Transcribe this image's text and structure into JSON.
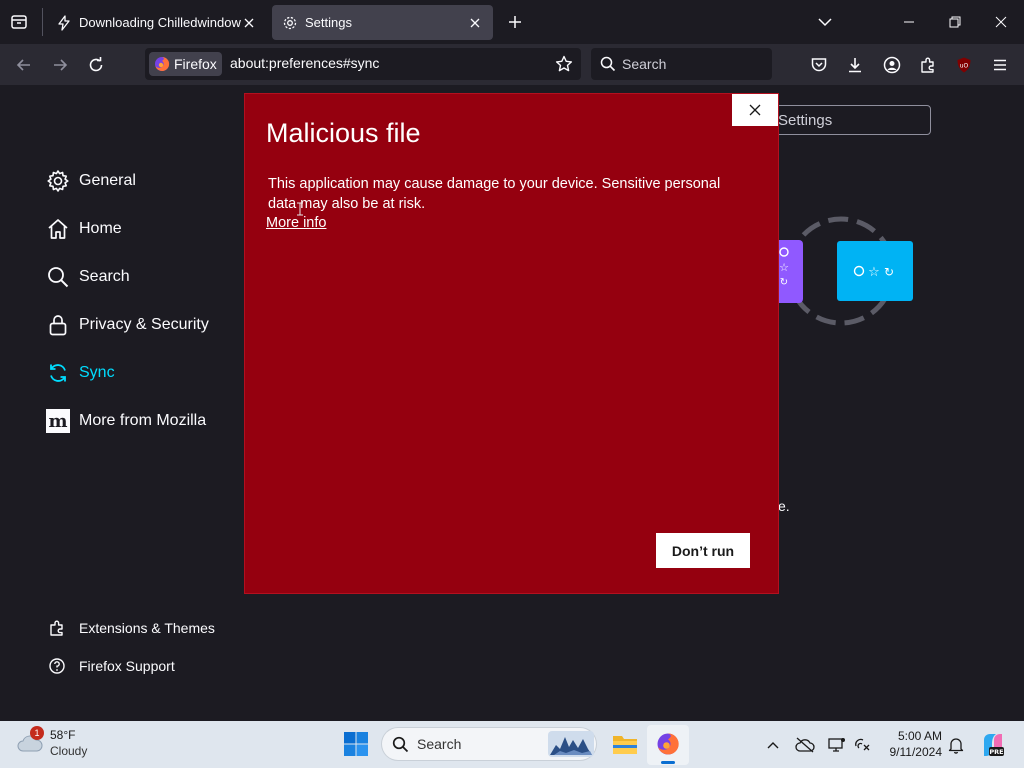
{
  "browser": {
    "tabs": [
      {
        "title": "Downloading Chilledwindows.e",
        "icon": "bolt-icon"
      },
      {
        "title": "Settings",
        "icon": "gear-icon"
      }
    ],
    "identity_label": "Firefox",
    "url": "about:preferences#sync",
    "search_placeholder": "Search"
  },
  "settings": {
    "categories": [
      {
        "label": "General",
        "icon": "gear-icon"
      },
      {
        "label": "Home",
        "icon": "home-icon"
      },
      {
        "label": "Search",
        "icon": "search-icon"
      },
      {
        "label": "Privacy & Security",
        "icon": "lock-icon"
      },
      {
        "label": "Sync",
        "icon": "sync-icon",
        "selected": true
      },
      {
        "label": "More from Mozilla",
        "icon": "mozilla-icon"
      }
    ],
    "footer_links": [
      {
        "label": "Extensions & Themes",
        "icon": "puzzle-icon"
      },
      {
        "label": "Firefox Support",
        "icon": "help-icon"
      }
    ],
    "find_placeholder": "Settings",
    "partial_text": "e."
  },
  "dialog": {
    "title": "Malicious file",
    "message": "This application may cause damage to your device. Sensitive personal data may also be at risk.",
    "more_info": "More info",
    "dont_run": "Don’t run",
    "background": "#95000f"
  },
  "taskbar": {
    "weather": {
      "temp": "58°F",
      "condition": "Cloudy",
      "badge": "1"
    },
    "search_placeholder": "Search",
    "time": "5:00 AM",
    "date": "9/11/2024"
  },
  "colors": {
    "accent": "#00ddff",
    "frame": "#1c1b22",
    "toolbar": "#2b2a33"
  }
}
